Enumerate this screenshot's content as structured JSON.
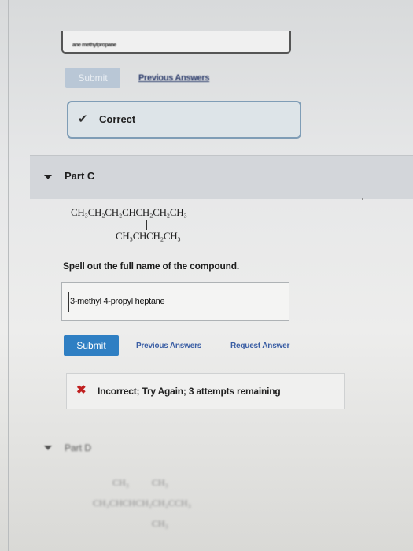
{
  "previous_part": {
    "input_text": "ane methylpropane",
    "submit_label": "Submit",
    "previous_answers_label": "Previous Answers",
    "feedback": "Correct"
  },
  "part_c": {
    "title": "Part C",
    "formula_main": "CH₃CH₂CH₂CHCH₂CH₂CH₃",
    "formula_branch": "CH₃CHCH₂CH₃",
    "instruction": "Spell out the full name of the compound.",
    "answer_value": "3-methyl 4-propyl heptane",
    "submit_label": "Submit",
    "previous_answers_label": "Previous Answers",
    "request_answer_label": "Request Answer",
    "feedback": "Incorrect; Try Again; 3 attempts remaining"
  },
  "part_d": {
    "title": "Part D",
    "structure_top_left": "CH₃",
    "structure_top_right": "CH₃",
    "structure_main": "CH₃CHCHCH₂CH₂CCH₃",
    "structure_bottom": "CH₃"
  }
}
